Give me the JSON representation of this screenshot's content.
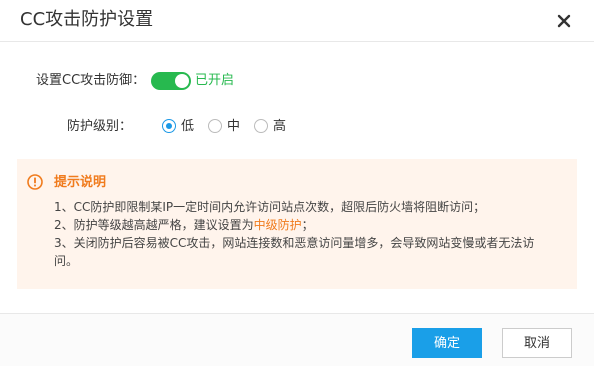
{
  "dialog": {
    "title": "CC攻击防护设置"
  },
  "settings": {
    "protection_label": "设置CC攻击防御：",
    "protection_status": "已开启",
    "protection_enabled": true,
    "level_label": "防护级别：",
    "levels": [
      {
        "label": "低",
        "selected": true
      },
      {
        "label": "中",
        "selected": false
      },
      {
        "label": "高",
        "selected": false
      }
    ]
  },
  "notice": {
    "title": "提示说明",
    "line1": "1、CC防护即限制某IP一定时间内允许访问站点次数，超限后防火墙将阻断访问；",
    "line2_prefix": "2、防护等级越高越严格，建议设置为",
    "line2_highlight": "中级防护",
    "line2_suffix": "；",
    "line3a": "3、关闭防护后容易被CC攻击，网站连接数和恶意访问量增多，会导致网站变慢或者无法访",
    "line3b": "问。"
  },
  "footer": {
    "ok_label": "确定",
    "cancel_label": "取消"
  },
  "colors": {
    "toggle_on": "#27b94f",
    "accent": "#1a98e6",
    "warning": "#f07b1d",
    "notice_bg": "#fff4ec",
    "primary_button": "#1a9fe8"
  },
  "icons": {
    "close": "close-icon",
    "notice": "warning-icon"
  }
}
